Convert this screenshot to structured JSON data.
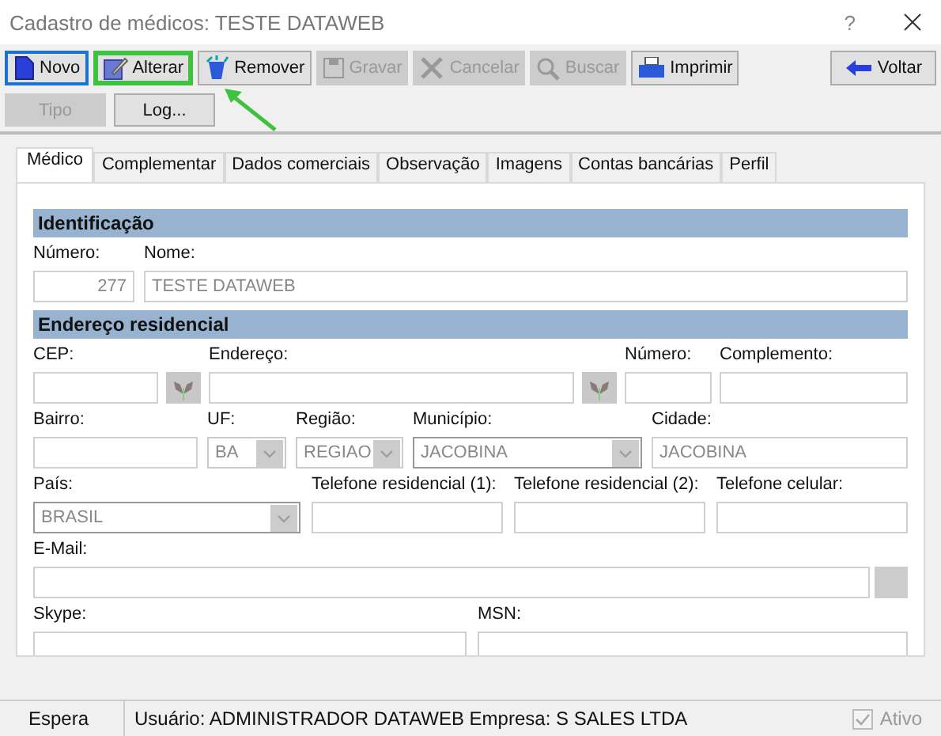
{
  "window": {
    "title": "Cadastro de médicos: TESTE DATAWEB",
    "help": "?"
  },
  "toolbar": [
    {
      "label": "Novo",
      "kind": "page",
      "disabled": false,
      "focused": true,
      "highlighted": false
    },
    {
      "label": "Alterar",
      "kind": "edit",
      "disabled": false,
      "focused": false,
      "highlighted": true
    },
    {
      "label": "Remover",
      "kind": "remove",
      "disabled": false,
      "focused": false,
      "highlighted": false
    },
    {
      "label": "Gravar",
      "kind": "save",
      "disabled": true,
      "focused": false,
      "highlighted": false
    },
    {
      "label": "Cancelar",
      "kind": "cancel",
      "disabled": true,
      "focused": false,
      "highlighted": false
    },
    {
      "label": "Buscar",
      "kind": "search",
      "disabled": true,
      "focused": false,
      "highlighted": false
    },
    {
      "label": "Imprimir",
      "kind": "print",
      "disabled": false,
      "focused": false,
      "highlighted": false
    },
    {
      "label": "Voltar",
      "kind": "back",
      "disabled": false,
      "focused": false,
      "highlighted": false
    }
  ],
  "secondary_buttons": [
    {
      "label": "Tipo",
      "disabled": true
    },
    {
      "label": "Log...",
      "disabled": false
    }
  ],
  "tabs": [
    {
      "label": "Médico",
      "selected": true
    },
    {
      "label": "Complementar",
      "selected": false
    },
    {
      "label": "Dados comerciais",
      "selected": false
    },
    {
      "label": "Observação",
      "selected": false
    },
    {
      "label": "Imagens",
      "selected": false
    },
    {
      "label": "Contas bancárias",
      "selected": false
    },
    {
      "label": "Perfil",
      "selected": false
    }
  ],
  "sections": [
    {
      "title": "Identificação",
      "lines": [
        {
          "fields": [
            {
              "kind": "number",
              "label": "Número:",
              "value": "277"
            },
            {
              "kind": "text",
              "label": "Nome:",
              "value": "TESTE DATAWEB"
            }
          ]
        }
      ]
    },
    {
      "title": "Endereço residencial",
      "lines": [
        {
          "fields": [
            {
              "kind": "text",
              "label": "CEP:"
            },
            {
              "kind": "lookup"
            },
            {
              "kind": "text",
              "label": "Endereço:"
            },
            {
              "kind": "lookup"
            },
            {
              "kind": "text",
              "label": "Número:"
            },
            {
              "kind": "text",
              "label": "Complemento:"
            }
          ]
        },
        {
          "fields": [
            {
              "kind": "text",
              "label": "Bairro:"
            },
            {
              "kind": "combo",
              "label": "UF:",
              "value": "BA",
              "disabled": true
            },
            {
              "kind": "combo",
              "label": "Região:",
              "value": "REGIAO",
              "disabled": true
            },
            {
              "kind": "combo",
              "label": "Município:",
              "value": "JACOBINA",
              "disabled": false
            },
            {
              "kind": "text",
              "label": "Cidade:",
              "value": "JACOBINA"
            }
          ]
        },
        {
          "fields": [
            {
              "kind": "combo",
              "label": "País:",
              "value": "BRASIL",
              "disabled": false
            },
            {
              "kind": "text",
              "label": "Telefone residencial (1):"
            },
            {
              "kind": "text",
              "label": "Telefone residencial (2):"
            },
            {
              "kind": "text",
              "label": "Telefone celular:"
            }
          ]
        },
        {
          "fields": [
            {
              "kind": "text",
              "label": "E-Mail:"
            },
            {
              "kind": "button"
            }
          ]
        },
        {
          "fields": [
            {
              "kind": "text",
              "label": "Skype:"
            },
            {
              "kind": "text",
              "label": "MSN:"
            }
          ]
        }
      ]
    }
  ],
  "status_bar": {
    "state": "Espera",
    "info": "Usuário: ADMINISTRADOR DATAWEB Empresa: S SALES LTDA",
    "active": {
      "label": "Ativo",
      "checked": true,
      "disabled": true
    }
  }
}
